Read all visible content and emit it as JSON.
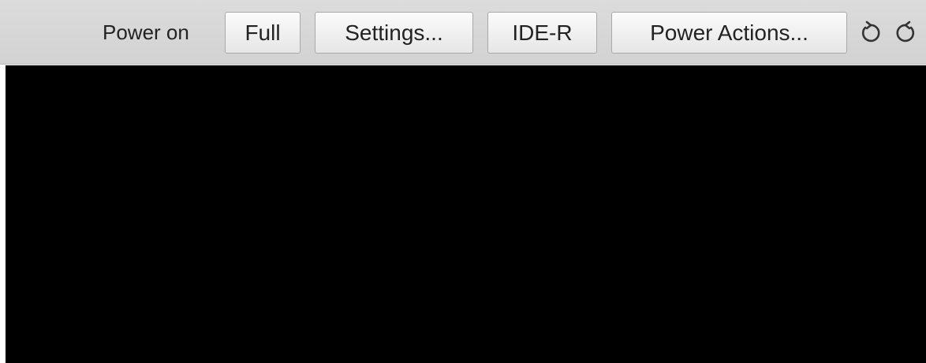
{
  "toolbar": {
    "status_label": "Power on",
    "buttons": {
      "full": "Full",
      "settings": "Settings...",
      "ider": "IDE-R",
      "power_actions": "Power Actions..."
    },
    "icons": [
      "rotate-counterclockwise-icon",
      "rotate-clockwise-icon"
    ]
  },
  "colors": {
    "toolbar_background": "#d6d6d6",
    "screen_background": "#000000",
    "button_border": "#a9a9a9",
    "text": "#222222"
  }
}
